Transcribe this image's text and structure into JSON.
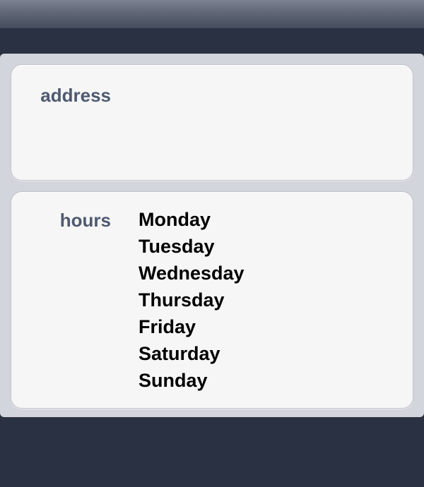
{
  "address": {
    "label": "address"
  },
  "hours": {
    "label": "hours",
    "days": [
      "Monday",
      "Tuesday",
      "Wednesday",
      "Thursday",
      "Friday",
      "Saturday",
      "Sunday"
    ]
  }
}
